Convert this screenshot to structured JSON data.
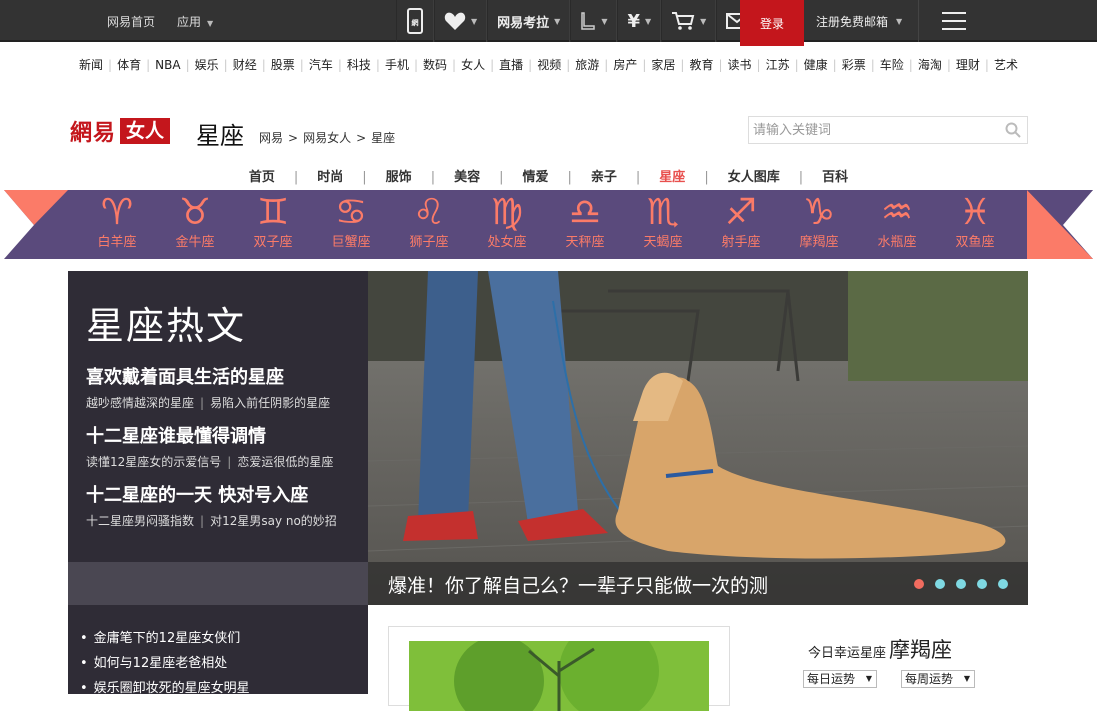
{
  "topbar": {
    "home": "网易首页",
    "apps": "应用",
    "tools_label": "网易考拉",
    "login": "登录",
    "mail": "注册免费邮箱"
  },
  "channels": [
    "新闻",
    "体育",
    "NBA",
    "娱乐",
    "财经",
    "股票",
    "汽车",
    "科技",
    "手机",
    "数码",
    "女人",
    "直播",
    "视频",
    "旅游",
    "房产",
    "家居",
    "教育",
    "读书",
    "江苏",
    "健康",
    "彩票",
    "车险",
    "海淘",
    "理财",
    "艺术"
  ],
  "header": {
    "logo_main": "網易",
    "logo_badge": "女人",
    "title": "星座",
    "breadcrumb": [
      "网易",
      "网易女人",
      "星座"
    ],
    "search_placeholder": "请输入关键词"
  },
  "subnav": [
    {
      "label": "首页",
      "active": false
    },
    {
      "label": "时尚",
      "active": false
    },
    {
      "label": "服饰",
      "active": false
    },
    {
      "label": "美容",
      "active": false
    },
    {
      "label": "情爱",
      "active": false
    },
    {
      "label": "亲子",
      "active": false
    },
    {
      "label": "星座",
      "active": true
    },
    {
      "label": "女人图库",
      "active": false
    },
    {
      "label": "百科",
      "active": false
    }
  ],
  "zodiac": [
    {
      "glyph": "♈",
      "name": "白羊座"
    },
    {
      "glyph": "♉",
      "name": "金牛座"
    },
    {
      "glyph": "♊",
      "name": "双子座"
    },
    {
      "glyph": "♋",
      "name": "巨蟹座"
    },
    {
      "glyph": "♌",
      "name": "狮子座"
    },
    {
      "glyph": "♍",
      "name": "处女座"
    },
    {
      "glyph": "♎",
      "name": "天秤座"
    },
    {
      "glyph": "♏",
      "name": "天蝎座"
    },
    {
      "glyph": "♐",
      "name": "射手座"
    },
    {
      "glyph": "♑",
      "name": "摩羯座"
    },
    {
      "glyph": "♒",
      "name": "水瓶座"
    },
    {
      "glyph": "♓",
      "name": "双鱼座"
    }
  ],
  "hot": {
    "title": "星座热文",
    "entries": [
      {
        "headline": "喜欢戴着面具生活的星座",
        "links": [
          "越吵感情越深的星座",
          "易陷入前任阴影的星座"
        ]
      },
      {
        "headline": "十二星座谁最懂得调情",
        "links": [
          "读懂12星座女的示爱信号",
          "恋爱运很低的星座"
        ]
      },
      {
        "headline": "十二星座的一天 快对号入座",
        "links": [
          "十二星座男闷骚指数",
          "对12星男say no的妙招"
        ]
      }
    ]
  },
  "slider": {
    "caption": "爆准！你了解自己么？一辈子只能做一次的测",
    "dot_count": 5,
    "active_dot": 0
  },
  "list": [
    "金庸笔下的12星座女侠们",
    "如何与12星座老爸相处",
    "娱乐圈卸妆死的星座女明星"
  ],
  "lucky": {
    "label": "今日幸运星座",
    "sign": "摩羯座",
    "daily": "每日运势",
    "weekly": "每周运势"
  },
  "colors": {
    "topbar": "#333333",
    "brand_red": "#c4161c",
    "zodiac_band": "#5a4a7c",
    "zodiac_accent": "#fb7b68",
    "hot_panel": "#2f2c36",
    "dot_active": "#f16c5f",
    "dot": "#7fd9e3"
  }
}
